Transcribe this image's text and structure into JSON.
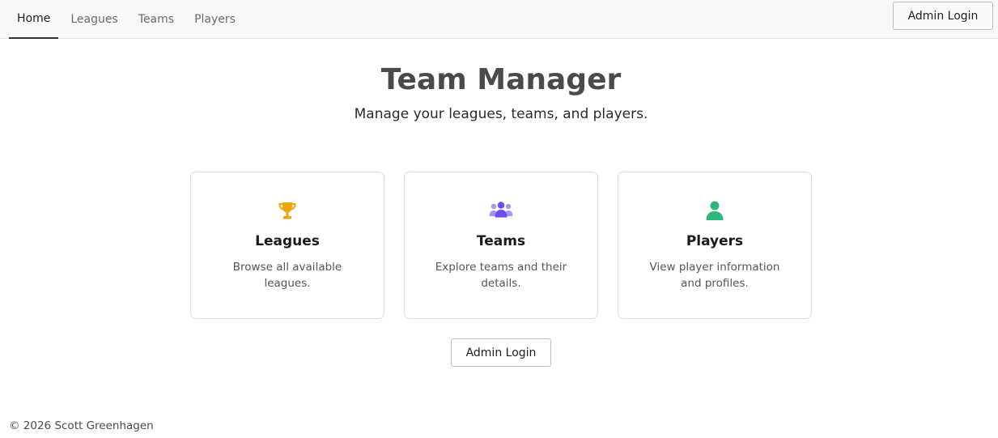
{
  "nav": {
    "links": [
      {
        "label": "Home",
        "active": true
      },
      {
        "label": "Leagues",
        "active": false
      },
      {
        "label": "Teams",
        "active": false
      },
      {
        "label": "Players",
        "active": false
      }
    ],
    "admin_login_label": "Admin Login"
  },
  "hero": {
    "title": "Team Manager",
    "subtitle": "Manage your leagues, teams, and players."
  },
  "cards": [
    {
      "icon": "trophy-icon",
      "icon_color": "#f0a30a",
      "title": "Leagues",
      "description": "Browse all available leagues."
    },
    {
      "icon": "users-icon",
      "icon_color": "#7b5cf0",
      "title": "Teams",
      "description": "Explore teams and their details."
    },
    {
      "icon": "user-icon",
      "icon_color": "#2fb67a",
      "title": "Players",
      "description": "View player information and profiles."
    }
  ],
  "admin_login_label": "Admin Login",
  "footer": {
    "copyright": "© 2026 Scott Greenhagen"
  }
}
